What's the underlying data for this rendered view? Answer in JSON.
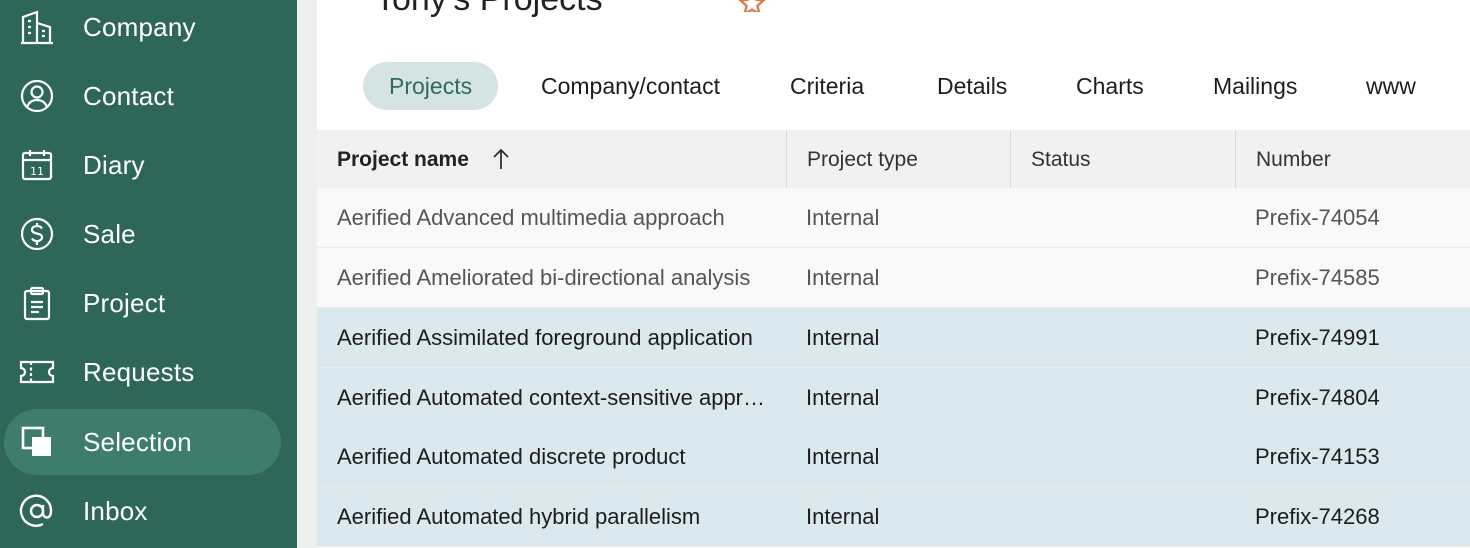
{
  "sidebar": {
    "items": [
      {
        "label": "Company",
        "icon": "building-icon"
      },
      {
        "label": "Contact",
        "icon": "person-circle-icon"
      },
      {
        "label": "Diary",
        "icon": "calendar-icon",
        "icon_text": "11"
      },
      {
        "label": "Sale",
        "icon": "dollar-circle-icon"
      },
      {
        "label": "Project",
        "icon": "clipboard-icon"
      },
      {
        "label": "Requests",
        "icon": "ticket-icon"
      },
      {
        "label": "Selection",
        "icon": "selection-squares-icon",
        "active": true
      },
      {
        "label": "Inbox",
        "icon": "at-sign-icon"
      }
    ]
  },
  "header": {
    "title": "Tony's Projects",
    "favorite_icon": "star-icon"
  },
  "tabs": [
    "Projects",
    "Company/contact",
    "Criteria",
    "Details",
    "Charts",
    "Mailings",
    "www"
  ],
  "active_tab": "Projects",
  "table": {
    "columns": [
      "Project name",
      "Project type",
      "Status",
      "Number"
    ],
    "sort": {
      "column": "Project name",
      "direction": "ascending",
      "icon": "arrow-up-icon"
    },
    "rows": [
      {
        "name": "Aerified Advanced multimedia approach",
        "type": "Internal",
        "status": "",
        "number": "Prefix-74054",
        "selected": false
      },
      {
        "name": "Aerified Ameliorated bi-directional analysis",
        "type": "Internal",
        "status": "",
        "number": "Prefix-74585",
        "selected": false
      },
      {
        "name": "Aerified Assimilated foreground application",
        "type": "Internal",
        "status": "",
        "number": "Prefix-74991",
        "selected": true
      },
      {
        "name": "Aerified Automated context-sensitive approach",
        "type": "Internal",
        "status": "",
        "number": "Prefix-74804",
        "selected": true
      },
      {
        "name": "Aerified Automated discrete product",
        "type": "Internal",
        "status": "",
        "number": "Prefix-74153",
        "selected": true
      },
      {
        "name": "Aerified Automated hybrid parallelism",
        "type": "Internal",
        "status": "",
        "number": "Prefix-74268",
        "selected": true
      }
    ]
  },
  "colors": {
    "sidebar_bg": "#2e6659",
    "sidebar_active": "#3e7d6c",
    "tab_active_bg": "#d5e4e3",
    "selected_row_bg": "#dbe9ee",
    "star_accent": "#e07a4a"
  }
}
